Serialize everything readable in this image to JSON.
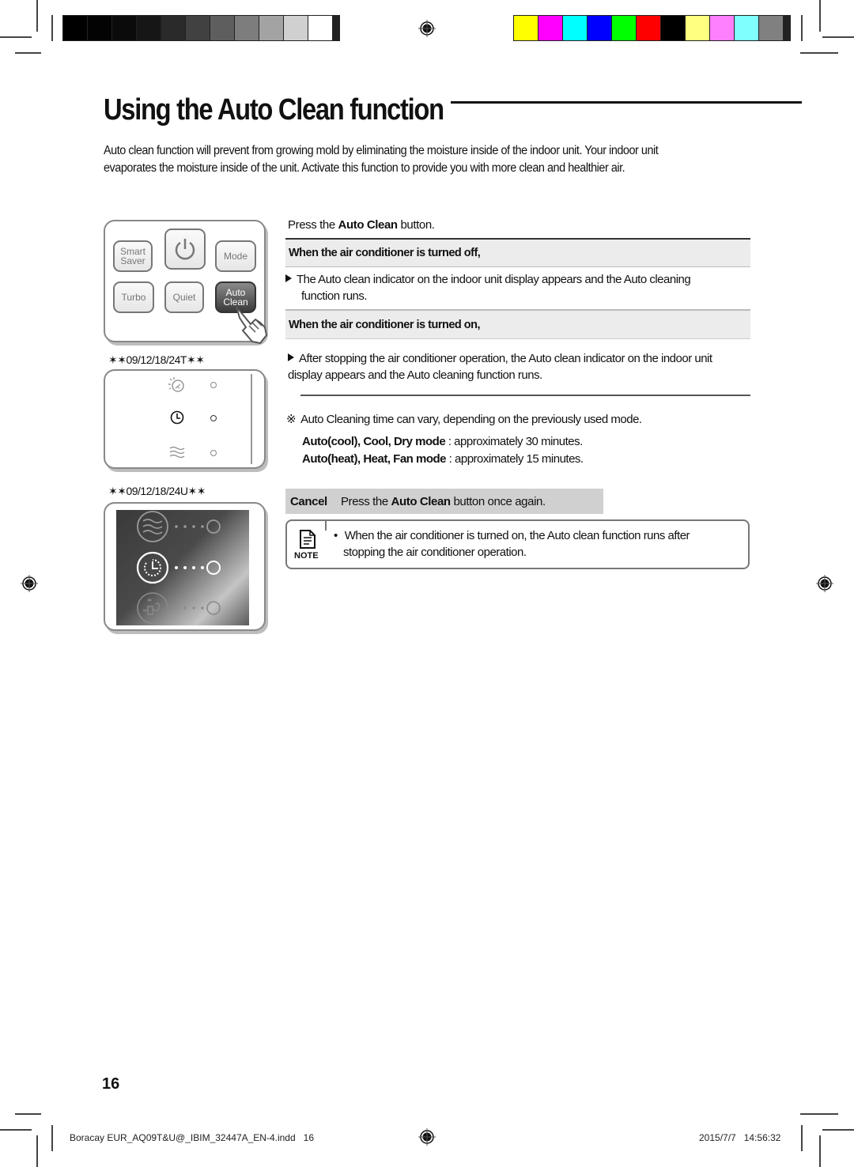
{
  "print_marks": {
    "grayscale_swatches": [
      "#000000",
      "#030303",
      "#0b0b0b",
      "#161616",
      "#2a2a2a",
      "#414141",
      "#5e5e5e",
      "#7d7d7d",
      "#a3a3a3",
      "#d0d0d0",
      "#ffffff"
    ],
    "color_swatches": [
      "#ffff00",
      "#ff00ff",
      "#00ffff",
      "#0000ff",
      "#00ff00",
      "#ff0000",
      "#000000",
      "#ffff80",
      "#ff80ff",
      "#80ffff",
      "#808080"
    ]
  },
  "page": {
    "title": "Using the Auto Clean function",
    "intro_line1": "Auto clean function will prevent from growing mold by eliminating the moisture inside of the indoor unit. Your indoor unit",
    "intro_line2": "evaporates the moisture inside of the unit. Activate this function to provide you with more clean and healthier air."
  },
  "remote": {
    "buttons": [
      {
        "label_line1": "Smart",
        "label_line2": "Saver"
      },
      {
        "label_line1": "",
        "label_line2": "",
        "icon": "power-icon"
      },
      {
        "label_line1": "Mode",
        "label_line2": ""
      },
      {
        "label_line1": "Turbo",
        "label_line2": ""
      },
      {
        "label_line1": "Quiet",
        "label_line2": ""
      },
      {
        "label_line1": "Auto",
        "label_line2": "Clean",
        "active": true
      }
    ]
  },
  "displays": {
    "model_t": "✶✶09/12/18/24T✶✶",
    "model_u": "✶✶09/12/18/24U✶✶",
    "t_icons": [
      "sun-sleep-icon",
      "auto-clean-timer-icon",
      "wave-icon"
    ],
    "u_icons": [
      "wave-icon",
      "auto-clean-timer-icon",
      "plug-sun-icon"
    ]
  },
  "instructions": {
    "step_prefix": "Press the ",
    "step_bold": "Auto Clean",
    "step_suffix": " button.",
    "off_header": "When the air conditioner is turned off,",
    "off_line1": "The Auto clean indicator on the indoor unit display appears and the Auto cleaning",
    "off_line2": "function runs.",
    "on_header": "When the air conditioner is turned on,",
    "on_line1": "After stopping the air conditioner operation, the Auto clean indicator on the indoor unit",
    "on_line2": "display appears and the Auto cleaning function runs.",
    "remark_symbol": "※",
    "remark": "Auto Cleaning time can vary, depending on the previously used mode.",
    "mode1_bold": "Auto(cool), Cool, Dry mode",
    "mode1_rest": " : approximately 30 minutes.",
    "mode2_bold": "Auto(heat), Heat, Fan mode",
    "mode2_rest": " : approximately 15 minutes.",
    "cancel_label": "Cancel",
    "cancel_prefix": "Press the ",
    "cancel_bold": "Auto Clean",
    "cancel_suffix": " button once again.",
    "note_label": "NOTE",
    "note_bullet": "•",
    "note_line1": "When the air conditioner is turned on, the Auto clean function runs after",
    "note_line2": "stopping the air conditioner operation."
  },
  "page_number": "16",
  "footer": {
    "file": "Boracay EUR_AQ09T&U@_IBIM_32447A_EN-4.indd   16",
    "timestamp": "2015/7/7   14:56:32"
  }
}
